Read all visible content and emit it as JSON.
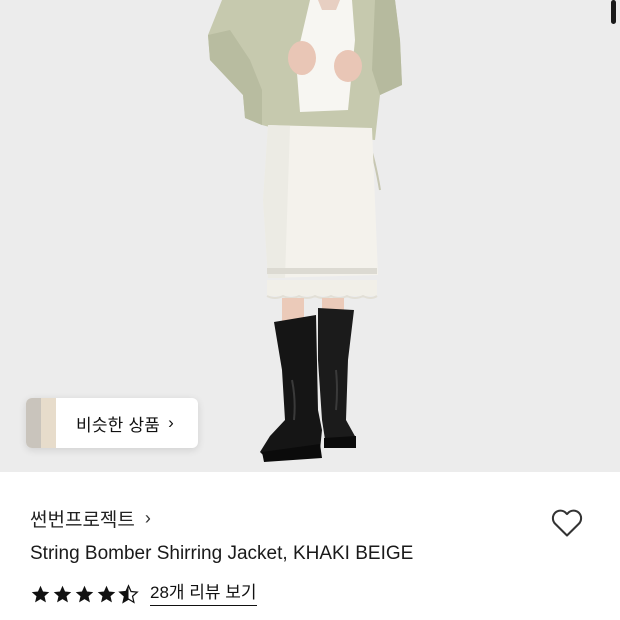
{
  "similar_products": {
    "label": "비슷한 상품",
    "chevron": "›"
  },
  "brand": {
    "name": "썬번프로젝트",
    "chevron": "›"
  },
  "product": {
    "title": "String Bomber Shirring Jacket, KHAKI BEIGE"
  },
  "rating": {
    "stars_filled": 4.5,
    "stars_total": 5,
    "review_link": "28개 리뷰 보기"
  },
  "icons": {
    "heart": "heart-outline-icon",
    "star": "star-icon",
    "chevron": "chevron-right-icon"
  },
  "colors": {
    "hero_background": "#ececec",
    "jacket": "#c6c9ae",
    "skirt": "#f4f2ec",
    "boots": "#151515",
    "star": "#111111"
  }
}
